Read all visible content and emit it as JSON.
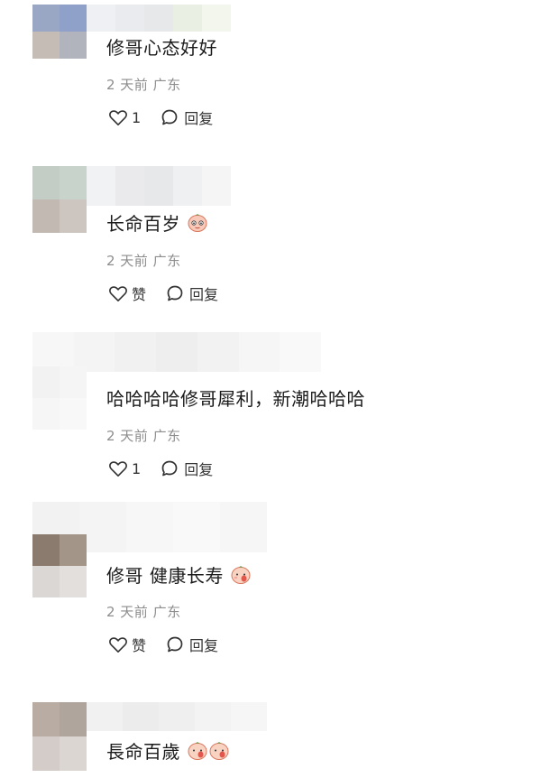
{
  "comments": [
    {
      "text": "修哥心态好好",
      "meta": "2 天前 广东",
      "like_label": "1",
      "reply_label": "回复",
      "emoji_count": 0
    },
    {
      "text": "长命百岁",
      "meta": "2 天前 广东",
      "like_label": "赞",
      "reply_label": "回复",
      "emoji_count": 1
    },
    {
      "text": "哈哈哈哈修哥犀利，新潮哈哈哈",
      "meta": "2 天前 广东",
      "like_label": "1",
      "reply_label": "回复",
      "emoji_count": 0
    },
    {
      "text": "修哥 健康长寿",
      "meta": "2 天前 广东",
      "like_label": "赞",
      "reply_label": "回复",
      "emoji_count": 1
    },
    {
      "text": "長命百歲",
      "meta": "",
      "like_label": "",
      "reply_label": "",
      "emoji_count": 2
    }
  ],
  "icons": {
    "like": "heart-outline-icon",
    "reply": "speech-bubble-icon",
    "emoji": "peach-face-emoji"
  }
}
